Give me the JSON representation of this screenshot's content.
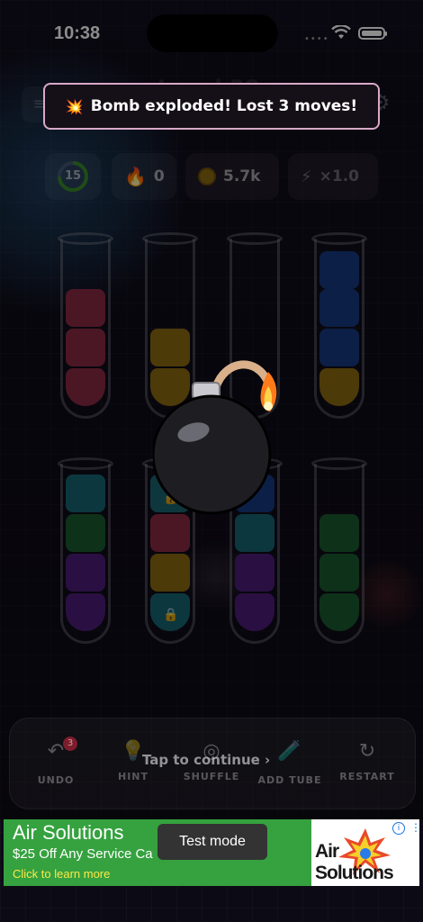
{
  "status_bar": {
    "time": "10:38",
    "signal": "••••"
  },
  "header": {
    "level_title": "Level 38",
    "menu_icon": "menu-icon",
    "settings_icon": "gear-icon"
  },
  "toast": {
    "icon": "explosion-icon",
    "message": "Bomb exploded! Lost 3 moves!"
  },
  "stats": {
    "timer": "15",
    "streak": "0",
    "coins": "5.7k",
    "multiplier": "×1.0"
  },
  "tubes": [
    {
      "colors": [
        "pink",
        "pink",
        "pink"
      ]
    },
    {
      "colors": [
        "yellow",
        "yellow"
      ]
    },
    {
      "colors": []
    },
    {
      "colors": [
        "yellow",
        "blue",
        "blue",
        "blue"
      ]
    },
    {
      "colors": [
        "purple",
        "purple",
        "green",
        "cyan"
      ]
    },
    {
      "colors": [
        "teal",
        "yellow",
        "pink",
        "hidden"
      ],
      "locked": true
    },
    {
      "colors": [
        "purple",
        "purple",
        "cyan",
        "blue"
      ]
    },
    {
      "colors": [
        "green",
        "green",
        "green"
      ]
    }
  ],
  "toolbar": {
    "undo_label": "UNDO",
    "undo_count": "3",
    "hint_label": "HINT",
    "shuffle_label": "SHUFFLE",
    "add_tube_label": "ADD TUBE",
    "restart_label": "RESTART",
    "tap_to_continue": "Tap to continue ›"
  },
  "ad": {
    "title": "Air Solutions",
    "offer": "$25 Off Any Service Ca",
    "cta": "Click to learn more",
    "logo_text": "Air Solutions",
    "test_mode": "Test mode"
  },
  "colors": {
    "pink": "#8a2a44",
    "yellow": "#8d6a12",
    "blue": "#173a80",
    "cyan": "#196573",
    "green": "#1a5a2e",
    "purple": "#4e1e78",
    "toast_border": "#d9a9c9",
    "ad_green": "#35a23f"
  }
}
